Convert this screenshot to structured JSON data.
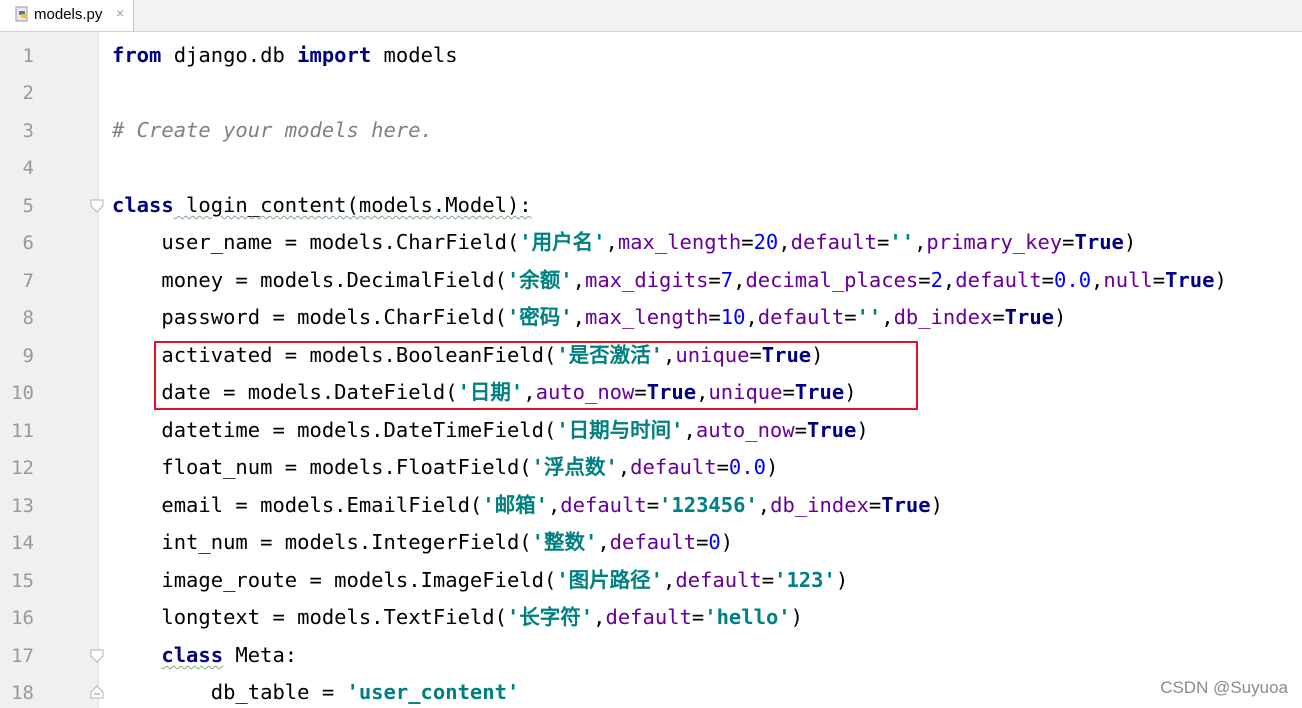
{
  "tab": {
    "filename": "models.py",
    "close_glyph": "×"
  },
  "line_numbers": [
    "1",
    "2",
    "3",
    "4",
    "5",
    "6",
    "7",
    "8",
    "9",
    "10",
    "11",
    "12",
    "13",
    "14",
    "15",
    "16",
    "17",
    "18"
  ],
  "code": {
    "l1": {
      "kw1": "from",
      "mod": " django.db ",
      "kw2": "import",
      "rest": " models"
    },
    "l3": {
      "comment": "# Create your models here."
    },
    "l5": {
      "kw": "class",
      "rest": " login_content(models.Model):"
    },
    "l6": {
      "a": "    user_name = models.CharField(",
      "s1": "'用户名'",
      "c1": ",",
      "p1": "max_length",
      "eq1": "=",
      "n1": "20",
      "c2": ",",
      "p2": "default",
      "eq2": "=",
      "s2": "''",
      "c3": ",",
      "p3": "primary_key",
      "eq3": "=",
      "k1": "True",
      "end": ")"
    },
    "l7": {
      "a": "    money = models.DecimalField(",
      "s1": "'余额'",
      "c1": ",",
      "p1": "max_digits",
      "eq1": "=",
      "n1": "7",
      "c2": ",",
      "p2": "decimal_places",
      "eq2": "=",
      "n2": "2",
      "c3": ",",
      "p3": "default",
      "eq3": "=",
      "n3": "0.0",
      "c4": ",",
      "p4": "null",
      "eq4": "=",
      "k1": "True",
      "end": ")"
    },
    "l8": {
      "a": "    password = models.CharField(",
      "s1": "'密码'",
      "c1": ",",
      "p1": "max_length",
      "eq1": "=",
      "n1": "10",
      "c2": ",",
      "p2": "default",
      "eq2": "=",
      "s2": "''",
      "c3": ",",
      "p3": "db_index",
      "eq3": "=",
      "k1": "True",
      "end": ")"
    },
    "l9": {
      "a": "    activated = models.BooleanField(",
      "s1": "'是否激活'",
      "c1": ",",
      "p1": "unique",
      "eq1": "=",
      "k1": "True",
      "end": ")"
    },
    "l10": {
      "a": "    date = models.DateField(",
      "s1": "'日期'",
      "c1": ",",
      "p1": "auto_now",
      "eq1": "=",
      "k1": "True",
      "c2": ",",
      "p2": "unique",
      "eq2": "=",
      "k2": "True",
      "end": ")"
    },
    "l11": {
      "a": "    datetime = models.DateTimeField(",
      "s1": "'日期与时间'",
      "c1": ",",
      "p1": "auto_now",
      "eq1": "=",
      "k1": "True",
      "end": ")"
    },
    "l12": {
      "a": "    float_num = models.FloatField(",
      "s1": "'浮点数'",
      "c1": ",",
      "p1": "default",
      "eq1": "=",
      "n1": "0.0",
      "end": ")"
    },
    "l13": {
      "a": "    email = models.EmailField(",
      "s1": "'邮箱'",
      "c1": ",",
      "p1": "default",
      "eq1": "=",
      "s2": "'123456'",
      "c2": ",",
      "p2": "db_index",
      "eq2": "=",
      "k1": "True",
      "end": ")"
    },
    "l14": {
      "a": "    int_num = models.IntegerField(",
      "s1": "'整数'",
      "c1": ",",
      "p1": "default",
      "eq1": "=",
      "n1": "0",
      "end": ")"
    },
    "l15": {
      "a": "    image_route = models.ImageField(",
      "s1": "'图片路径'",
      "c1": ",",
      "p1": "default",
      "eq1": "=",
      "s2": "'123'",
      "end": ")"
    },
    "l16": {
      "a": "    longtext = models.TextField(",
      "s1": "'长字符'",
      "c1": ",",
      "p1": "default",
      "eq1": "=",
      "s2": "'hello'",
      "end": ")"
    },
    "l17": {
      "indent": "    ",
      "kw": "class",
      "rest": " Meta:"
    },
    "l18": {
      "a": "        db_table = ",
      "s1": "'user_content'"
    }
  },
  "watermark": "CSDN @Suyuoa",
  "colors": {
    "keyword": "#000080",
    "string": "#008080",
    "number": "#0000ff",
    "param": "#660099",
    "comment": "#808080",
    "highlight_box": "#e0141e"
  }
}
